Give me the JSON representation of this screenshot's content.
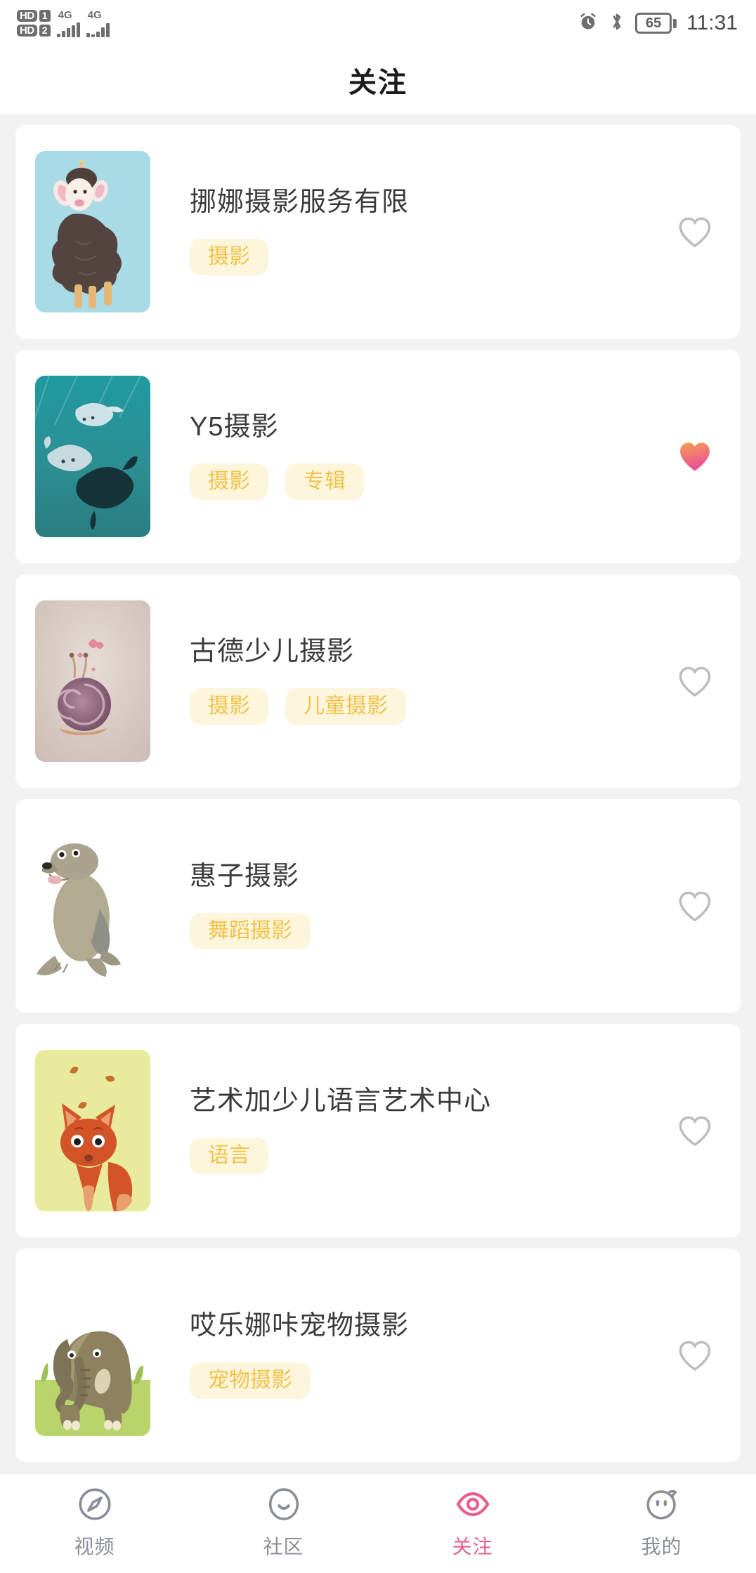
{
  "status_bar": {
    "hd1_label": "HD",
    "hd2_label": "HD",
    "sim1_label": "1",
    "sim2_label": "2",
    "network1": "4G",
    "network2": "4G",
    "alarm_icon": "alarm-icon",
    "bluetooth_icon": "bluetooth-icon",
    "battery_percent": "65",
    "time": "11:31"
  },
  "header": {
    "title": "关注"
  },
  "theme": {
    "page_background": "#f2f2f2",
    "card_background": "#ffffff",
    "tag_background": "#fdf6dc",
    "tag_text": "#f2c24a",
    "accent_pink": "#e7608d",
    "heart_gradient_start": "#f5a051",
    "heart_gradient_end": "#ee4d9b",
    "heart_outline": "#b9b9b9",
    "nav_inactive": "#8b8e99"
  },
  "list": {
    "items": [
      {
        "name": "挪娜摄影服务有限",
        "tags": [
          "摄影"
        ],
        "favorited": false,
        "thumb_name": "sheep-unicorn-thumbnail"
      },
      {
        "name": "Y5摄影",
        "tags": [
          "摄影",
          "专辑"
        ],
        "favorited": true,
        "thumb_name": "stingray-underwater-thumbnail"
      },
      {
        "name": "古德少儿摄影",
        "tags": [
          "摄影",
          "儿童摄影"
        ],
        "favorited": false,
        "thumb_name": "snail-hearts-thumbnail"
      },
      {
        "name": "惠子摄影",
        "tags": [
          "舞蹈摄影"
        ],
        "favorited": false,
        "thumb_name": "seal-thumbnail"
      },
      {
        "name": "艺术加少儿语言艺术中心",
        "tags": [
          "语言"
        ],
        "favorited": false,
        "thumb_name": "fox-autumn-thumbnail"
      },
      {
        "name": "哎乐娜咔宠物摄影",
        "tags": [
          "宠物摄影"
        ],
        "favorited": false,
        "thumb_name": "elephant-grass-thumbnail"
      }
    ]
  },
  "tabbar": {
    "items": [
      {
        "label": "视频",
        "icon": "compass-icon",
        "active": false
      },
      {
        "label": "社区",
        "icon": "smiley-face-icon",
        "active": false
      },
      {
        "label": "关注",
        "icon": "eye-icon",
        "active": true
      },
      {
        "label": "我的",
        "icon": "pig-face-icon",
        "active": false
      }
    ]
  }
}
